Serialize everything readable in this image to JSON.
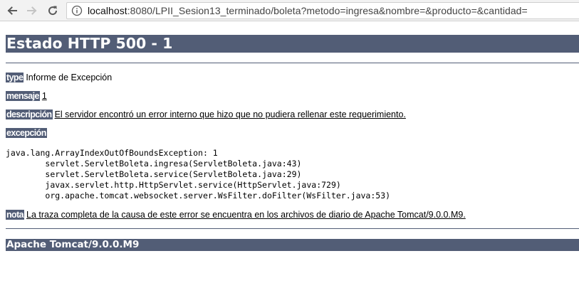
{
  "browser": {
    "url_host": "localhost",
    "url_rest": ":8080/LPII_Sesion13_terminado/boleta?metodo=ingresa&nombre=&producto=&cantidad="
  },
  "page": {
    "title": "Estado HTTP 500 - 1",
    "type_label": "type",
    "type_value": "Informe de Excepción",
    "message_label": "mensaje",
    "message_value": "1",
    "description_label": "descripción",
    "description_value": "El servidor encontró un error interno que hizo que no pudiera rellenar este requerimiento.",
    "exception_label": "excepción",
    "stack_trace": [
      "java.lang.ArrayIndexOutOfBoundsException: 1",
      "\tservlet.ServletBoleta.ingresa(ServletBoleta.java:43)",
      "\tservlet.ServletBoleta.service(ServletBoleta.java:29)",
      "\tjavax.servlet.http.HttpServlet.service(HttpServlet.java:729)",
      "\torg.apache.tomcat.websocket.server.WsFilter.doFilter(WsFilter.java:53)"
    ],
    "note_label": "nota",
    "note_value": "La traza completa de la causa de este error se encuentra en los archivos de diario de Apache Tomcat/9.0.0.M9.",
    "footer": "Apache Tomcat/9.0.0.M9"
  },
  "colors": {
    "header_bg": "#525d76"
  }
}
